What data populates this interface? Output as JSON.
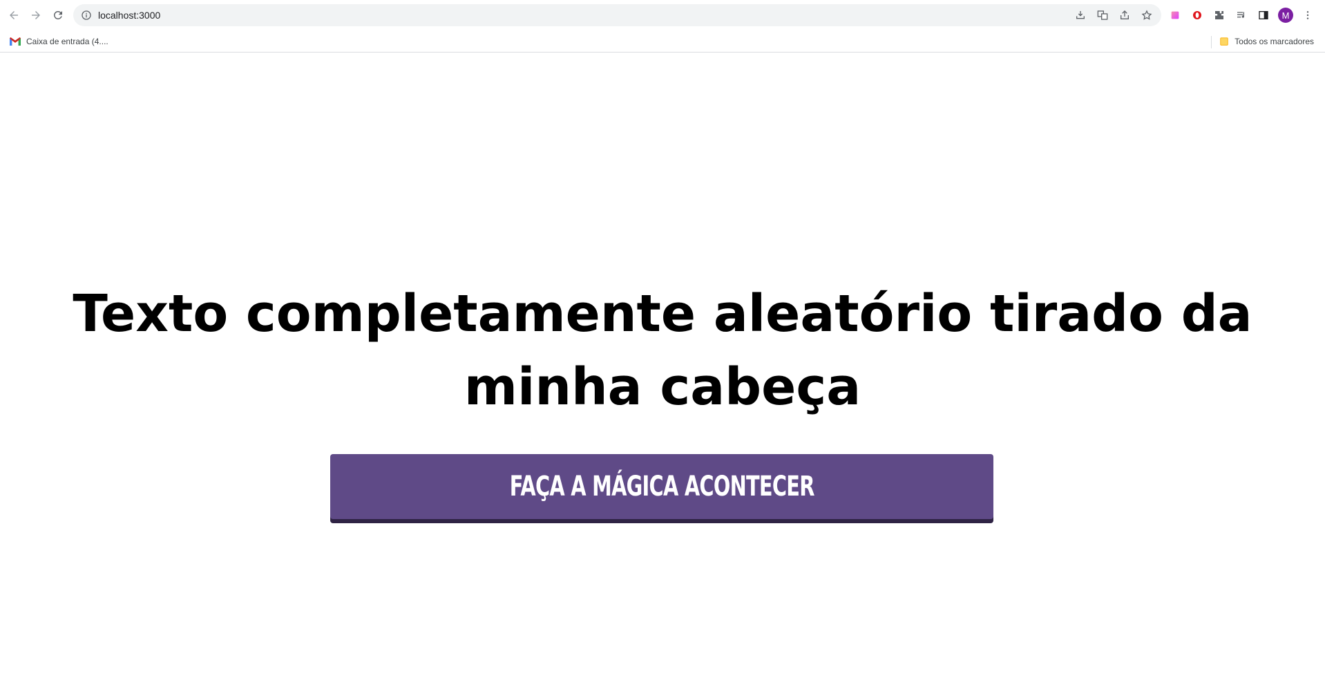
{
  "browser": {
    "url": "localhost:3000",
    "avatar_initial": "M",
    "bookmarks": {
      "left_item": "Caixa de entrada (4....",
      "right_item": "Todos os marcadores"
    }
  },
  "page": {
    "headline": "Texto completamente aleatório tirado da minha cabeça",
    "button_label": "FAÇA A MÁGICA ACONTECER",
    "button_color": "#5f4a87"
  }
}
